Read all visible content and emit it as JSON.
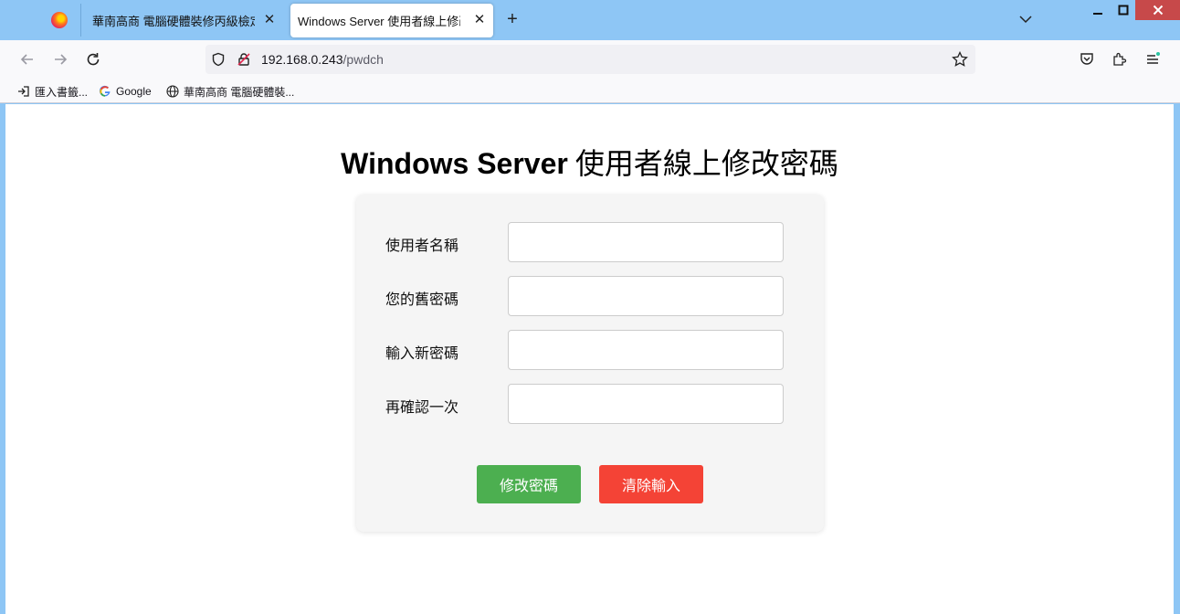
{
  "browser": {
    "tabs": [
      {
        "label": "華南高商 電腦硬體裝修丙級檢定術科"
      },
      {
        "label": "Windows Server 使用者線上修改密碼"
      }
    ],
    "tab_close_glyph": "✕",
    "new_tab_glyph": "+",
    "url_host": "192.168.0.243",
    "url_path": "/pwdch",
    "bookmarks": [
      {
        "label": "匯入書籤...",
        "icon": "import-icon"
      },
      {
        "label": "Google",
        "icon": "google-icon"
      },
      {
        "label": "華南高商 電腦硬體裝...",
        "icon": "globe-icon"
      }
    ]
  },
  "page": {
    "title_latin": "Windows Server",
    "title_cjk": " 使用者線上修改密碼",
    "form": {
      "fields": [
        {
          "label": "使用者名稱",
          "value": ""
        },
        {
          "label": "您的舊密碼",
          "value": ""
        },
        {
          "label": "輸入新密碼",
          "value": ""
        },
        {
          "label": "再確認一次",
          "value": ""
        }
      ],
      "submit_label": "修改密碼",
      "clear_label": "清除輸入"
    }
  },
  "colors": {
    "submit": "#4caf50",
    "clear": "#f44336",
    "tabstrip": "#8ec6f5"
  }
}
